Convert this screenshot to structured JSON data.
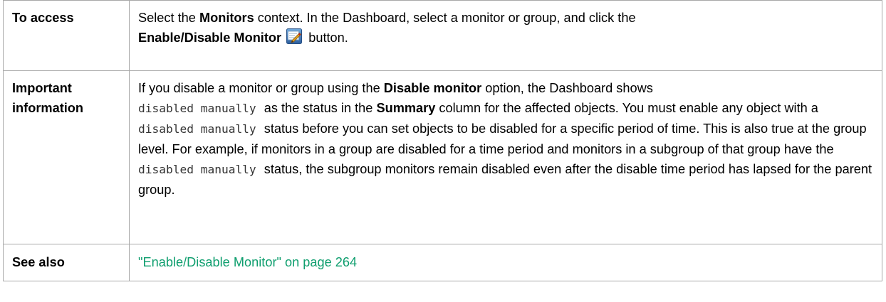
{
  "rows": {
    "access": {
      "label": "To access",
      "text_1": "Select the ",
      "bold_monitors": "Monitors",
      "text_2": " context. In the Dashboard, select a monitor or group, and click the ",
      "bold_button": "Enable/Disable Monitor",
      "icon": "enable-disable-monitor-icon",
      "text_3": " button."
    },
    "important": {
      "label_line1": "Important",
      "label_line2": "information",
      "text_1": "If you disable a monitor or group using the ",
      "bold_disable": "Disable monitor",
      "text_2": " option, the Dashboard shows ",
      "code_1": "disabled manually",
      "text_3": " as the status in the ",
      "bold_summary": "Summary",
      "text_4": " column for the affected objects. You must enable any object with a ",
      "code_2": "disabled manually",
      "text_5": " status before you can set objects to be disabled for a specific period of time. This is also true at the group level. For example, if monitors in a group are disabled for a time period and monitors in a subgroup of that group have the ",
      "code_3": "disabled manually",
      "text_6": " status, the subgroup monitors remain disabled even after the disable time period has lapsed for the parent group."
    },
    "see_also": {
      "label": "See also",
      "link": "\"Enable/Disable Monitor\" on page 264"
    }
  },
  "colors": {
    "border": "#a8a8a8",
    "link": "#0e9e6e"
  }
}
